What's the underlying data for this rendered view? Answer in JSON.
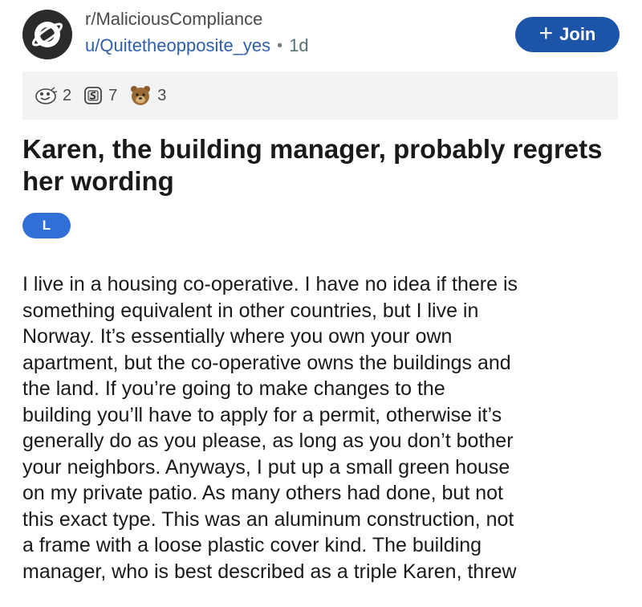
{
  "header": {
    "subreddit": "r/MaliciousCompliance",
    "username": "u/Quitetheopposite_yes",
    "separator": "•",
    "age": "1d",
    "join_label": "Join",
    "join_icon": "plus-icon"
  },
  "awards": [
    {
      "icon": "award-face-icon",
      "count": "2"
    },
    {
      "icon": "award-silver-icon",
      "count": "7"
    },
    {
      "icon": "award-bear-icon",
      "count": "3"
    }
  ],
  "post": {
    "title": "Karen, the building manager, probably regrets her wording",
    "flair": "L",
    "body_lines": [
      "I live in a housing co-operative. I have no idea if there is",
      "something equivalent in other countries, but I live in",
      "Norway. It’s essentially where you own your own",
      "apartment, but the co-operative owns the buildings and",
      "the land. If you’re going to make changes to the",
      "building you’ll have to apply for a permit, otherwise it’s",
      "generally do as you please, as long as you don’t bother",
      "your neighbors. Anyways, I put up a small green house",
      "on my private patio. As many others had done, but not",
      "this exact type. This was an aluminum construction, not",
      "a frame with a loose plastic cover kind. The building",
      "manager, who is best described as a triple Karen, threw"
    ]
  },
  "colors": {
    "join_button": "#1c54a8",
    "flair": "#2f6fd6",
    "username": "#2f5fa8",
    "awards_bar": "#f2f3f4"
  }
}
